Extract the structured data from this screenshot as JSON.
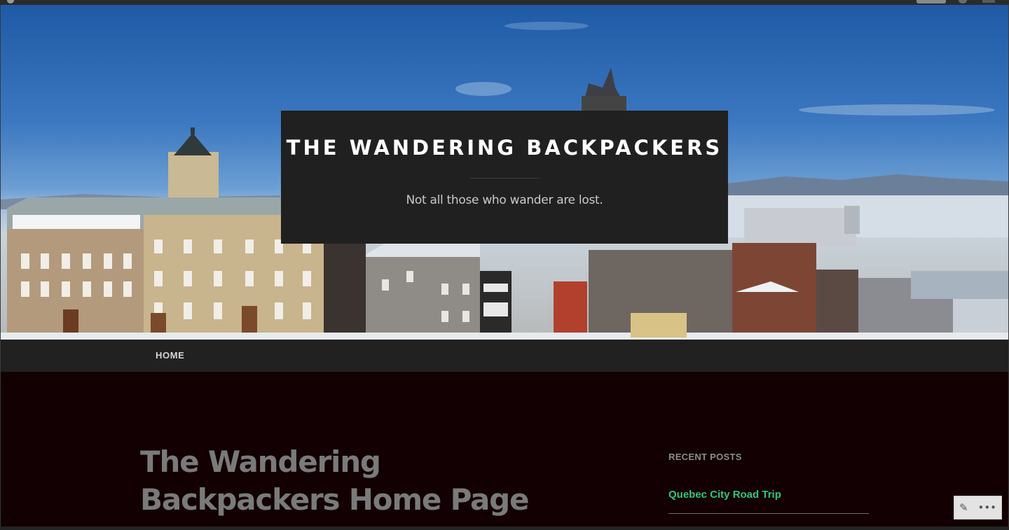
{
  "site": {
    "title": "THE WANDERING BACKPACKERS",
    "tagline": "Not all those who wander are lost."
  },
  "nav": {
    "items": [
      {
        "label": "HOME"
      }
    ]
  },
  "main": {
    "page_title": "The Wandering Backpackers Home Page"
  },
  "sidebar": {
    "widget_title": "RECENT POSTS",
    "recent_posts": [
      {
        "label": "Quebec City Road Trip"
      }
    ]
  },
  "edit_widget": {
    "edit_icon": "pencil-icon",
    "more_icon": "more-icon",
    "edit_glyph": "✎",
    "more_glyph": "•••"
  },
  "colors": {
    "content_bg": "#120002",
    "nav_bg": "#212121",
    "title_box_bg": "#202020",
    "link_accent": "#33c57b"
  }
}
